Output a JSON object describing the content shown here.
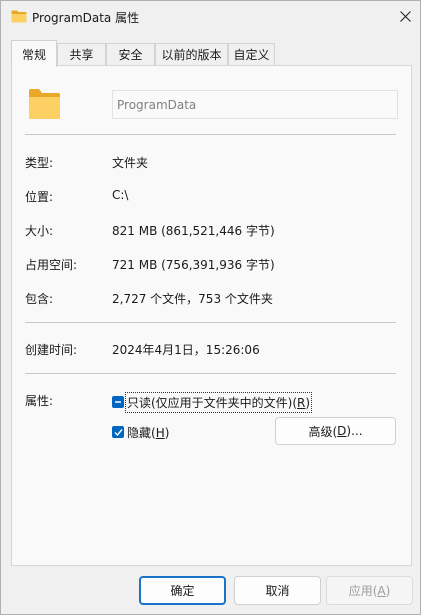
{
  "window": {
    "title": "ProgramData 属性"
  },
  "tabs": [
    {
      "label": "常规",
      "active": true
    },
    {
      "label": "共享"
    },
    {
      "label": "安全"
    },
    {
      "label": "以前的版本"
    },
    {
      "label": "自定义"
    }
  ],
  "general": {
    "name_value": "ProgramData",
    "rows": {
      "type": {
        "label": "类型:",
        "value": "文件夹"
      },
      "location": {
        "label": "位置:",
        "value": "C:\\"
      },
      "size": {
        "label": "大小:",
        "value": "821 MB (861,521,446 字节)"
      },
      "size_on_disk": {
        "label": "占用空间:",
        "value": "721 MB (756,391,936 字节)"
      },
      "contains": {
        "label": "包含:",
        "value": "2,727 个文件，753 个文件夹"
      },
      "created": {
        "label": "创建时间:",
        "value": "2024年4月1日，15:26:06"
      }
    },
    "attributes": {
      "label": "属性:",
      "readonly": {
        "text": "只读(仅应用于文件夹中的文件)(",
        "key": "R",
        "close": ")",
        "state": "indeterminate"
      },
      "hidden": {
        "text": "隐藏(",
        "key": "H",
        "close": ")",
        "state": "checked"
      },
      "advanced": {
        "text": "高级(",
        "key": "D",
        "close": ")..."
      }
    }
  },
  "footer": {
    "ok": "确定",
    "cancel": "取消",
    "apply_text": "应用(",
    "apply_key": "A",
    "apply_close": ")"
  },
  "colors": {
    "accent": "#0067c0",
    "folder": "#f8c44a"
  }
}
